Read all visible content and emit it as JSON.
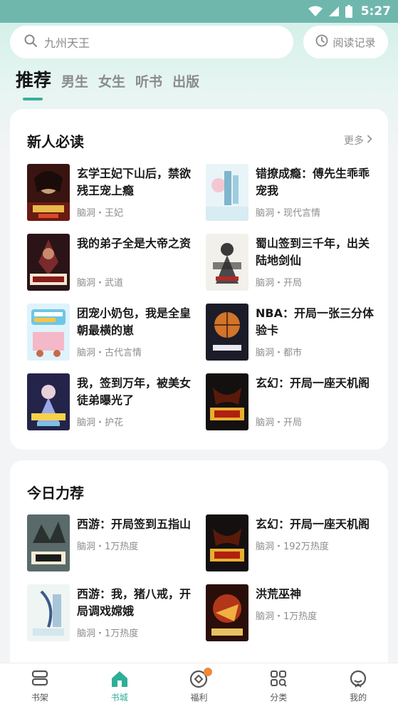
{
  "status_bar": {
    "time": "5:27"
  },
  "search": {
    "placeholder": "九州天王",
    "history_label": "阅读记录"
  },
  "tabs": [
    {
      "label": "推荐",
      "active": true
    },
    {
      "label": "男生"
    },
    {
      "label": "女生"
    },
    {
      "label": "听书"
    },
    {
      "label": "出版"
    }
  ],
  "section_new": {
    "title": "新人必读",
    "more": "更多",
    "books": [
      {
        "title": "玄学王妃下山后，禁欲残王宠上瘾",
        "meta": "脑洞・王妃"
      },
      {
        "title": "错撩成瘾：傅先生乖乖宠我",
        "meta": "脑洞・现代言情"
      },
      {
        "title": "我的弟子全是大帝之资",
        "meta": "脑洞・武道"
      },
      {
        "title": "蜀山签到三千年，出关陆地剑仙",
        "meta": "脑洞・开局"
      },
      {
        "title": "团宠小奶包，我是全皇朝最横的崽",
        "meta": "脑洞・古代言情"
      },
      {
        "title": "NBA：开局一张三分体验卡",
        "meta": "脑洞・都市"
      },
      {
        "title": "我，签到万年，被美女徒弟曝光了",
        "meta": "脑洞・护花"
      },
      {
        "title": "玄幻：开局一座天机阁",
        "meta": "脑洞・开局"
      }
    ]
  },
  "section_today": {
    "title": "今日力荐",
    "books": [
      {
        "title": "西游：开局签到五指山",
        "meta": "脑洞・1万热度"
      },
      {
        "title": "玄幻：开局一座天机阁",
        "meta": "脑洞・192万热度"
      },
      {
        "title": "西游：我，猪八戒，开局调戏嫦娥",
        "meta": "脑洞・1万热度"
      },
      {
        "title": "洪荒巫神",
        "meta": "脑洞・1万热度"
      }
    ]
  },
  "bottom_nav": [
    {
      "label": "书架",
      "icon": "bookshelf-icon"
    },
    {
      "label": "书城",
      "icon": "bookstore-icon",
      "active": true
    },
    {
      "label": "福利",
      "icon": "welfare-icon"
    },
    {
      "label": "分类",
      "icon": "category-icon"
    },
    {
      "label": "我的",
      "icon": "profile-icon"
    }
  ],
  "colors": {
    "accent": "#2fae98",
    "status_bar": "#6fb7ad"
  }
}
